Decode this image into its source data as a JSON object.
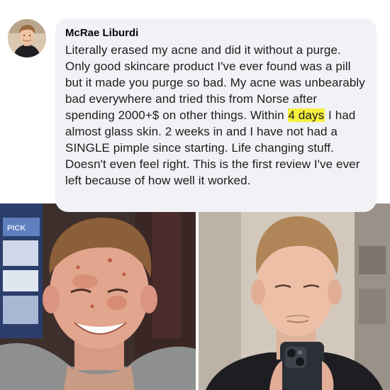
{
  "comment": {
    "author": "McRae Liburdi",
    "text_before_highlight": "Literally erased my acne and did it without a purge. Only good skincare product I've ever found was a pill but it made you purge so bad. My acne was unbearably bad everywhere and tried this from Norse after spending 2000+$ on other things. Within ",
    "highlight": "4 days",
    "text_after_highlight": " I had almost glass skin. 2 weeks in and I have not had a SINGLE pimple since starting. Life changing stuff. Doesn't even feel right. This is the first review I've ever left because of how well it worked."
  },
  "photos": {
    "before_sign_text": "PICK"
  },
  "colors": {
    "bubble_background": "#f0f2f5",
    "highlight": "#f5f13c",
    "author_text": "#050505",
    "body_text": "#1c1c1c"
  },
  "icons": {
    "avatar": "profile-photo"
  }
}
